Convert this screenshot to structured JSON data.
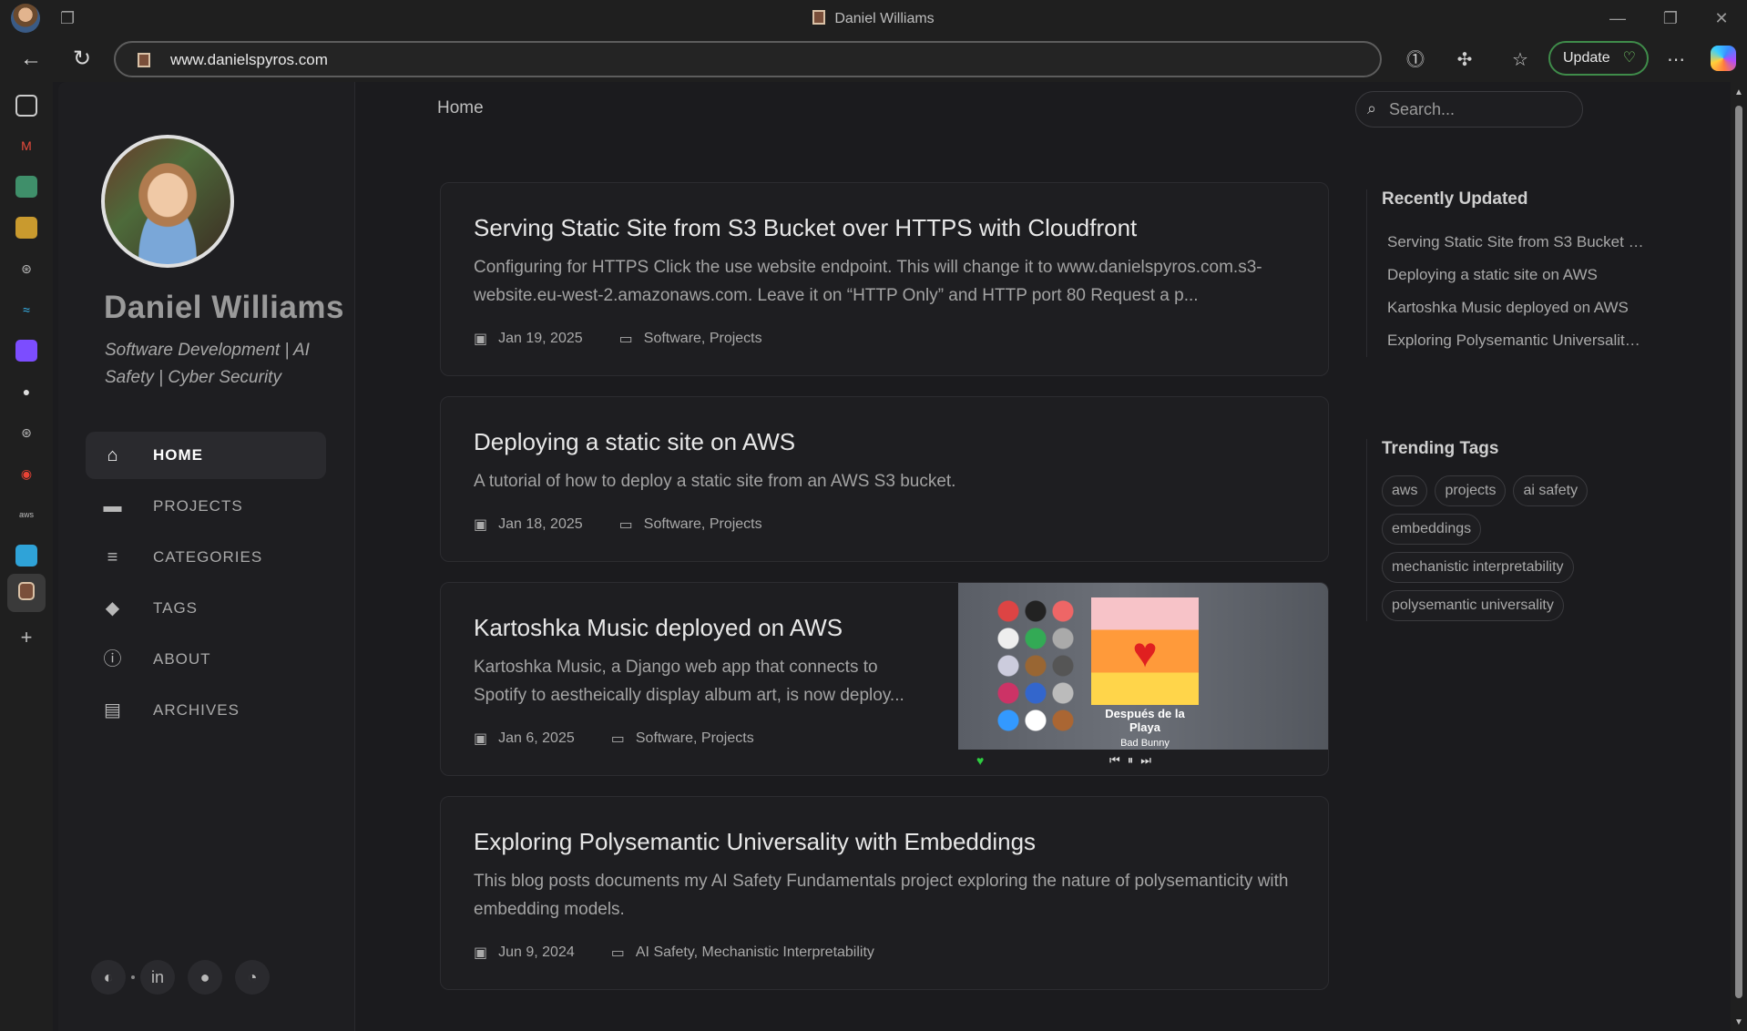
{
  "browser": {
    "window_title": "Daniel Williams",
    "url": "www.danielspyros.com",
    "update_label": "Update"
  },
  "site": {
    "title": "Daniel Williams",
    "subtitle": "Software Development | AI Safety | Cyber Security",
    "nav": [
      {
        "label": "HOME",
        "icon": "home-icon",
        "active": true
      },
      {
        "label": "PROJECTS",
        "icon": "folder-icon"
      },
      {
        "label": "CATEGORIES",
        "icon": "list-icon"
      },
      {
        "label": "TAGS",
        "icon": "tags-icon"
      },
      {
        "label": "ABOUT",
        "icon": "info-icon"
      },
      {
        "label": "ARCHIVES",
        "icon": "archive-icon"
      }
    ]
  },
  "topbar": {
    "breadcrumb": "Home",
    "search_placeholder": "Search..."
  },
  "posts": [
    {
      "title": "Serving Static Site from S3 Bucket over HTTPS with Cloudfront",
      "excerpt": "Configuring for HTTPS Click the use website endpoint. This will change it to www.danielspyros.com.s3-website.eu-west-2.amazonaws.com. Leave it on “HTTP Only” and HTTP port 80 Request a p...",
      "date": "Jan 19, 2025",
      "categories": "Software, Projects"
    },
    {
      "title": "Deploying a static site on AWS",
      "excerpt": "A tutorial of how to deploy a static site from an AWS S3 bucket.",
      "date": "Jan 18, 2025",
      "categories": "Software, Projects"
    },
    {
      "title": "Kartoshka Music deployed on AWS",
      "excerpt": "Kartoshka Music, a Django web app that connects to Spotify to aestheically display album art, is now deploy...",
      "date": "Jan 6, 2025",
      "categories": "Software, Projects",
      "image": {
        "track": "Después de la Playa",
        "artist": "Bad Bunny"
      }
    },
    {
      "title": "Exploring Polysemantic Universality with Embeddings",
      "excerpt": "This blog posts documents my AI Safety Fundamentals project exploring the nature of polysemanticity with embedding models.",
      "date": "Jun 9, 2024",
      "categories": "AI Safety, Mechanistic Interpretability"
    }
  ],
  "recently_updated": {
    "heading": "Recently Updated",
    "items": [
      "Serving Static Site from S3 Bucket ov...",
      "Deploying a static site on AWS",
      "Kartoshka Music deployed on AWS",
      "Exploring Polysemantic Universality ..."
    ]
  },
  "trending_tags": {
    "heading": "Trending Tags",
    "tags": [
      "aws",
      "projects",
      "ai safety",
      "embeddings",
      "mechanistic interpretability",
      "polysemantic universality"
    ]
  }
}
